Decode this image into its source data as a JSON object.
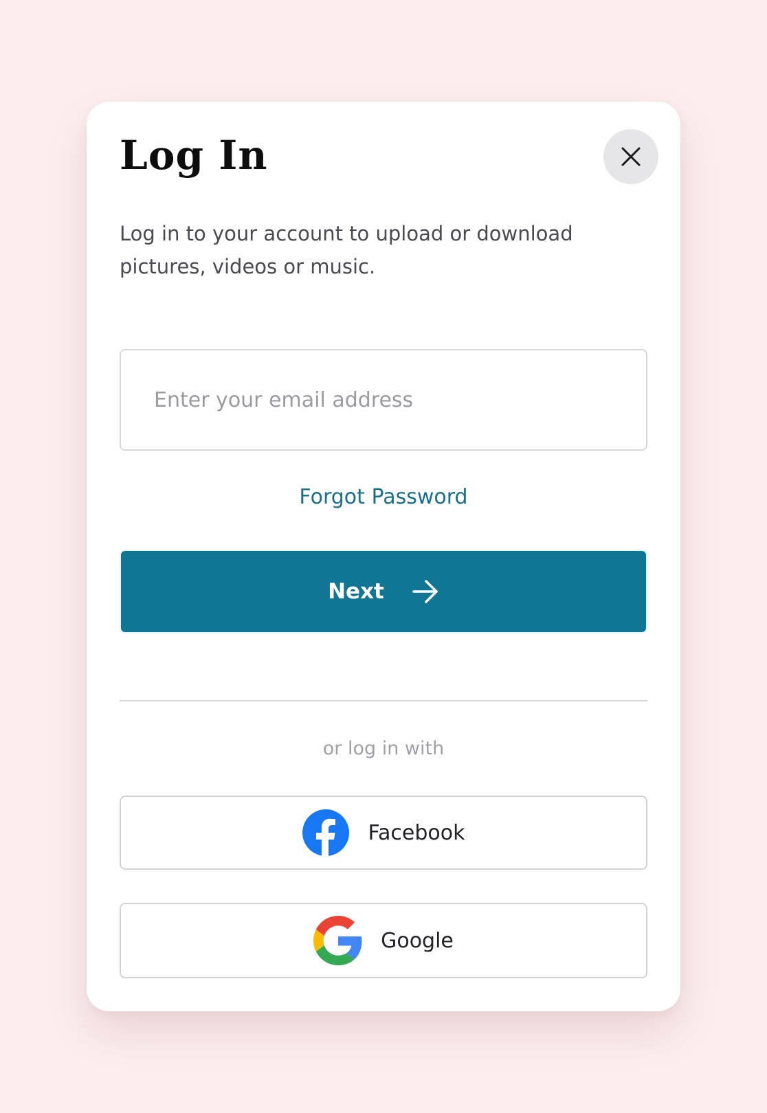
{
  "modal": {
    "title": "Log In",
    "subtitle": "Log in to your account to upload or download pictures, videos or music.",
    "close_icon": "close-icon"
  },
  "form": {
    "email_placeholder": "Enter your email address",
    "email_value": "",
    "forgot_password_label": "Forgot Password",
    "next_label": "Next",
    "next_icon": "arrow-right-icon"
  },
  "social": {
    "divider_text": "or log in with",
    "buttons": [
      {
        "label": "Facebook",
        "icon": "facebook-icon"
      },
      {
        "label": "Google",
        "icon": "google-icon"
      }
    ]
  },
  "colors": {
    "background": "#fdeeee",
    "accent": "#117594",
    "link": "#1a6f8a",
    "facebook": "#1877f2"
  }
}
